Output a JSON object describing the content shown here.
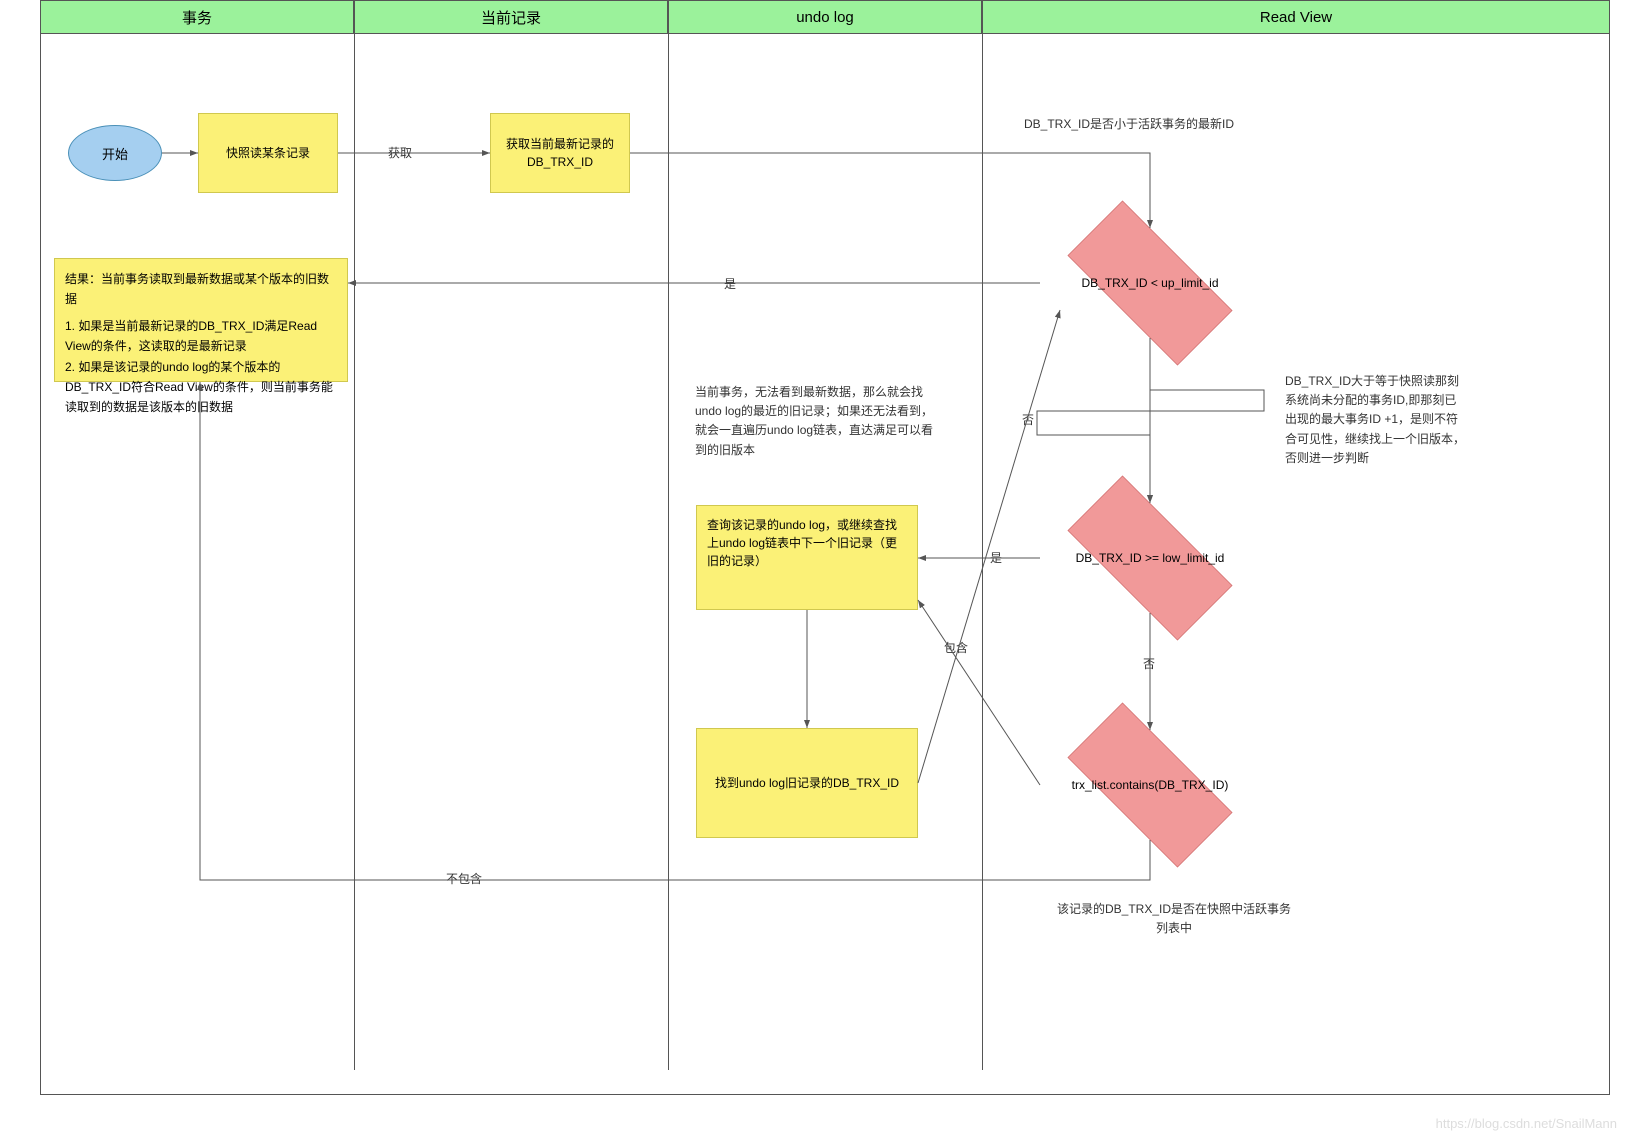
{
  "lanes": {
    "l1": "事务",
    "l2": "当前记录",
    "l3": "undo log",
    "l4": "Read View"
  },
  "nodes": {
    "start": "开始",
    "snapshot": "快照读某条记录",
    "get_trx": "获取当前最新记录的\nDB_TRX_ID",
    "d1": "DB_TRX_ID < up_limit_id",
    "d2": "DB_TRX_ID >= low_limit_id",
    "d3": "trx_list.contains(DB_TRX_ID)",
    "undo_query": "查询该记录的undo log，或继续查找上undo log链表中下一个旧记录（更旧的记录）",
    "undo_found": "找到undo log旧记录的DB_TRX_ID",
    "result": {
      "title": "结果：当前事务读取到最新数据或某个版本的旧数据",
      "item1": "1. 如果是当前最新记录的DB_TRX_ID满足Read View的条件，这读取的是最新记录",
      "item2": "2. 如果是该记录的undo log的某个版本的DB_TRX_ID符合Read View的条件，则当前事务能读取到的数据是该版本的旧数据"
    }
  },
  "annotations": {
    "a1": "DB_TRX_ID是否小于活跃事务的最新ID",
    "a2": "DB_TRX_ID大于等于快照读那刻系统尚未分配的事务ID,即那刻已出现的最大事务ID +1，是则不符合可见性，继续找上一个旧版本，否则进一步判断",
    "a3": "该记录的DB_TRX_ID是否在快照中活跃事务列表中",
    "a4": "当前事务，无法看到最新数据，那么就会找undo log的最近的旧记录；如果还无法看到，就会一直遍历undo log链表，直达满足可以看到的旧版本"
  },
  "edge_labels": {
    "get": "获取",
    "yes": "是",
    "no": "否",
    "contains": "包含",
    "not_contains": "不包含"
  },
  "watermark": "https://blog.csdn.net/SnailMann"
}
